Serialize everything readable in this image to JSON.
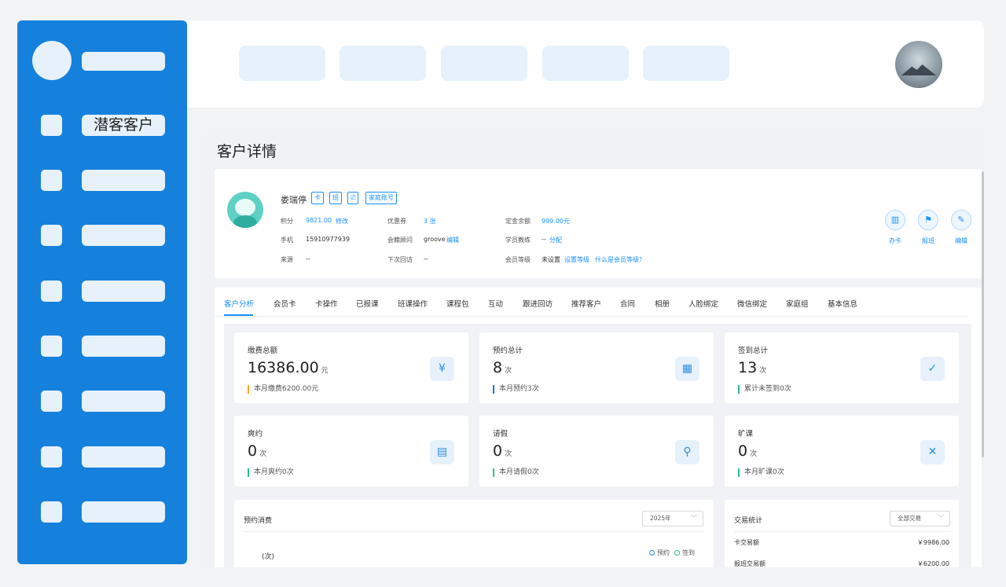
{
  "sidebar": {
    "items": [
      {
        "label": "潜客客户"
      },
      {
        "label": ""
      },
      {
        "label": ""
      },
      {
        "label": ""
      },
      {
        "label": ""
      },
      {
        "label": ""
      },
      {
        "label": ""
      },
      {
        "label": ""
      }
    ]
  },
  "page": {
    "title": "客户详情"
  },
  "profile": {
    "name": "娄瑞停",
    "tags": [
      "卡",
      "班",
      "⎚",
      "家庭账号"
    ],
    "points_label": "积分",
    "points_value": "9821.00",
    "points_action": "修改",
    "coupon_label": "优惠券",
    "coupon_value": "3 张",
    "deposit_label": "定金余额",
    "deposit_value": "999.00元",
    "phone_label": "手机",
    "phone_value": "15910977939",
    "advisor_label": "会籍顾问",
    "advisor_value": "groove",
    "advisor_action": "编辑",
    "coach_label": "学员教练",
    "coach_value": "--",
    "coach_action": "分配",
    "source_label": "来源",
    "source_value": "--",
    "visit_label": "下次回访",
    "visit_value": "--",
    "level_label": "会员等级",
    "level_value": "未设置",
    "level_action": "设置等级",
    "level_help": "什么是会员等级?",
    "actions": [
      {
        "label": "办卡",
        "icon": "card-icon"
      },
      {
        "label": "报班",
        "icon": "class-icon"
      },
      {
        "label": "编辑",
        "icon": "edit-icon"
      }
    ]
  },
  "tabs": [
    "客户分析",
    "会员卡",
    "卡操作",
    "已报课",
    "班课操作",
    "课程包",
    "互动",
    "跟进回访",
    "推荐客户",
    "合同",
    "相册",
    "人脸绑定",
    "微信绑定",
    "家庭组",
    "基本信息"
  ],
  "stats": [
    {
      "title": "缴费总额",
      "value": "16386.00",
      "unit": "元",
      "sub": "本月缴费6200.00元",
      "icon": "yen-refresh-icon",
      "accent": "#f5a623"
    },
    {
      "title": "预约总计",
      "value": "8",
      "unit": "次",
      "sub": "本月预约3次",
      "icon": "calendar-clock-icon",
      "accent": "#1677d8"
    },
    {
      "title": "签到总计",
      "value": "13",
      "unit": "次",
      "sub": "累计未签到0次",
      "icon": "calendar-check-icon",
      "accent": "#2fbf8f"
    },
    {
      "title": "爽约",
      "value": "0",
      "unit": "次",
      "sub": "本月爽约0次",
      "icon": "document-clock-icon",
      "accent": "#2fbf8f"
    },
    {
      "title": "请假",
      "value": "0",
      "unit": "次",
      "sub": "本月请假0次",
      "icon": "user-search-icon",
      "accent": "#2fbf8f"
    },
    {
      "title": "旷课",
      "value": "0",
      "unit": "次",
      "sub": "本月旷课0次",
      "icon": "calendar-x-icon",
      "accent": "#2fbf8f"
    }
  ],
  "consumption": {
    "title": "预约消费",
    "year": "2025年",
    "y_unit": "(次)",
    "legend": [
      "预约",
      "签到"
    ]
  },
  "transactions": {
    "title": "交易统计",
    "filter": "全部交易",
    "rows": [
      {
        "label": "卡交易额",
        "value": "￥9986.00"
      },
      {
        "label": "报班交易额",
        "value": "￥6200.00"
      }
    ]
  },
  "colors": {
    "brand": "#1681dc",
    "link": "#1890ff",
    "placeholder": "#e6f1fb"
  }
}
